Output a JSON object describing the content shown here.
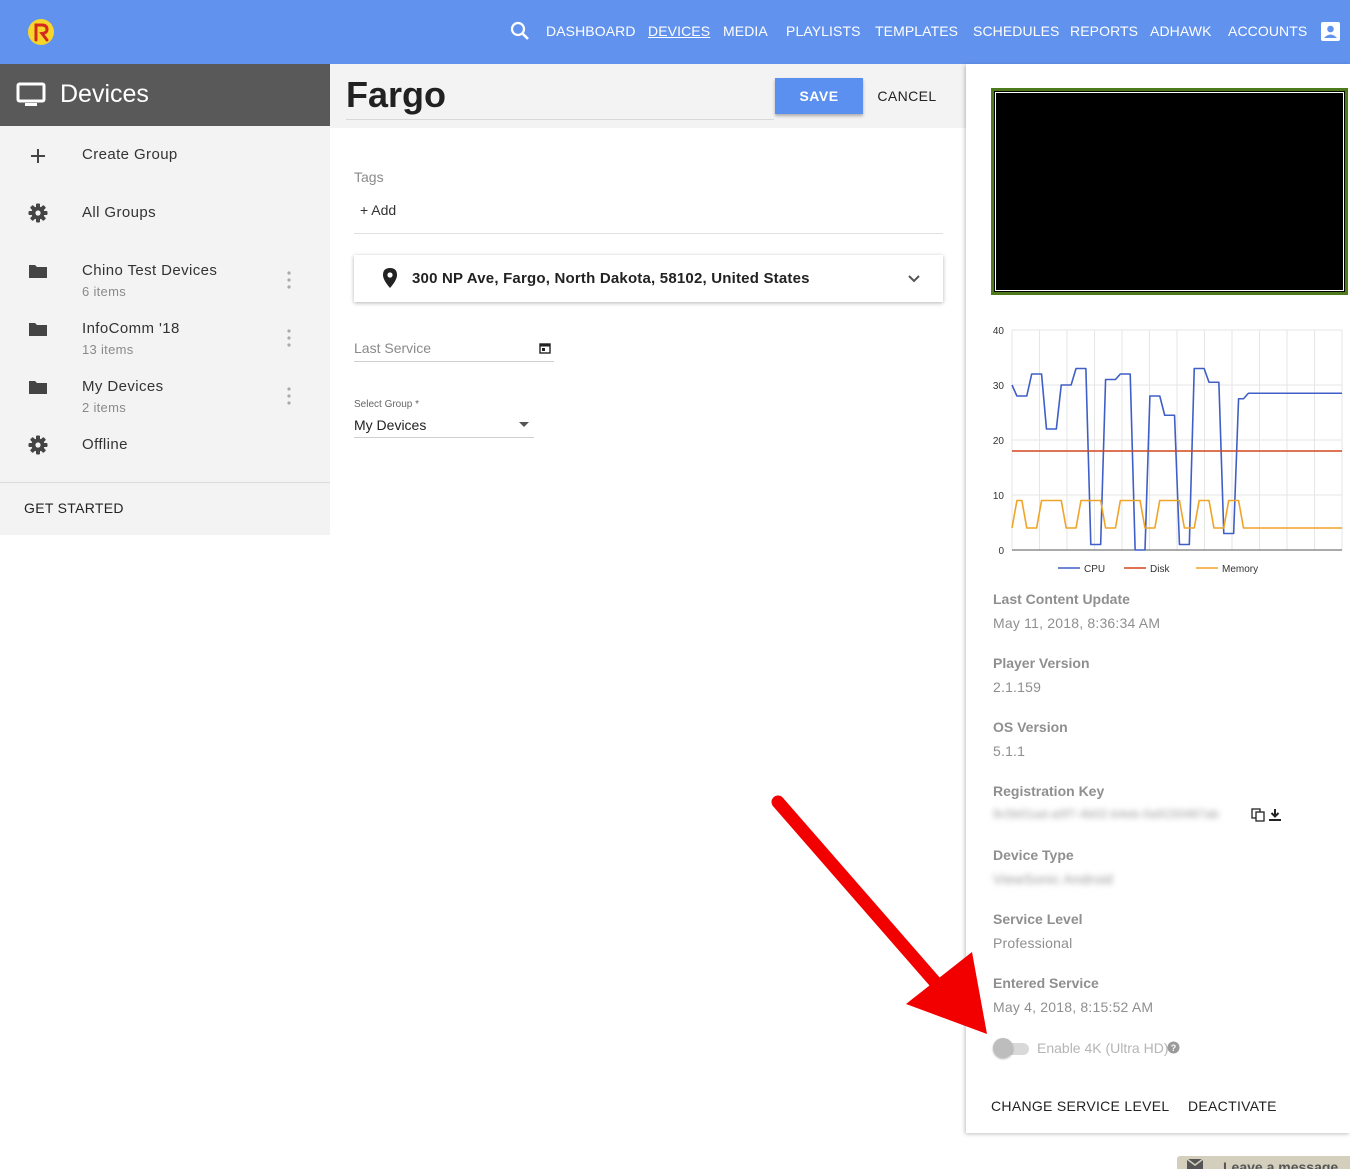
{
  "nav": {
    "items": [
      "DASHBOARD",
      "DEVICES",
      "MEDIA",
      "PLAYLISTS",
      "TEMPLATES",
      "SCHEDULES",
      "REPORTS",
      "ADHAWK",
      "ACCOUNTS"
    ],
    "active": "DEVICES",
    "brand_color": "#6193ee"
  },
  "sidebar": {
    "title": "Devices",
    "items": [
      {
        "label": "Create Group",
        "icon": "plus-icon"
      },
      {
        "label": "All Groups",
        "icon": "gear-icon"
      },
      {
        "label": "Chino Test Devices",
        "sub": "6 items",
        "icon": "folder-icon"
      },
      {
        "label": "InfoComm '18",
        "sub": "13 items",
        "icon": "folder-icon"
      },
      {
        "label": "My Devices",
        "sub": "2 items",
        "icon": "folder-icon"
      },
      {
        "label": "Offline",
        "icon": "gear-icon"
      }
    ],
    "get_started": "GET STARTED"
  },
  "editor": {
    "device_name": "Fargo",
    "save_label": "SAVE",
    "cancel_label": "CANCEL",
    "tags_label": "Tags",
    "tags_add": "+ Add",
    "address": "300 NP Ave, Fargo, North Dakota, 58102, United States",
    "last_service_placeholder": "Last Service",
    "select_group_label": "Select Group *",
    "select_group_value": "My Devices"
  },
  "details": {
    "fields": [
      {
        "label": "Last Content Update",
        "value": "May 11, 2018, 8:36:34 AM"
      },
      {
        "label": "Player Version",
        "value": "2.1.159"
      },
      {
        "label": "OS Version",
        "value": "5.1.1"
      },
      {
        "label": "Registration Key",
        "value": "9c5b01ad-a0f7-4b02-b4eb-0a9150487ab",
        "blurred": true
      },
      {
        "label": "Device Type",
        "value": "ViewSonic Android",
        "blurred": true
      },
      {
        "label": "Service Level",
        "value": "Professional"
      },
      {
        "label": "Entered Service",
        "value": "May 4, 2018, 8:15:52 AM"
      }
    ],
    "toggle_4k_label": "Enable 4K (Ultra HD)",
    "toggle_4k_on": false,
    "change_service_level": "CHANGE SERVICE LEVEL",
    "deactivate": "DEACTIVATE"
  },
  "leave_message": "Leave a message",
  "chart_data": {
    "type": "line",
    "ylim": [
      0,
      40
    ],
    "yticks": [
      0,
      10,
      20,
      30,
      40
    ],
    "x": [
      0,
      0.25,
      0.5,
      0.75,
      1,
      1.25,
      1.5,
      1.75,
      2,
      2.25,
      2.5,
      2.75,
      3,
      3.25,
      3.5,
      3.75,
      4,
      4.25,
      4.5,
      4.75,
      5,
      5.25,
      5.5,
      5.75,
      6,
      6.25,
      6.5,
      6.75,
      7,
      7.25,
      7.5,
      7.75,
      8,
      8.25,
      8.5,
      8.75,
      9,
      9.25,
      9.5,
      9.75,
      10,
      10.25,
      10.5,
      10.75,
      11,
      11.25,
      11.5,
      11.75,
      12,
      12.25,
      12.5,
      12.75,
      13,
      13.25,
      13.5,
      13.75,
      14,
      14.25,
      14.5,
      14.75,
      15,
      15.25,
      15.5,
      15.75,
      16,
      16.25,
      16.5,
      16.75
    ],
    "series": [
      {
        "name": "CPU",
        "color": "#3f5fc7",
        "values": [
          30,
          28,
          28,
          28,
          32,
          32,
          32,
          22,
          22,
          22,
          30,
          30,
          30,
          33,
          33,
          33,
          1,
          1,
          1,
          31,
          31,
          31,
          32,
          32,
          32,
          0,
          0,
          0,
          28,
          28,
          28,
          24.5,
          24.5,
          24.5,
          1,
          1,
          1,
          33,
          33,
          33,
          30.5,
          30.5,
          30.5,
          3,
          3,
          3,
          27.5,
          27.5,
          28.5,
          28.5,
          28.5,
          28.5,
          28.5,
          28.5,
          28.5,
          28.5,
          28.5,
          28.5,
          28.5,
          28.5,
          28.5,
          28.5,
          28.5,
          28.5,
          28.5,
          28.5,
          28.5,
          28.5
        ]
      },
      {
        "name": "Disk",
        "color": "#d2461f",
        "values": [
          18,
          18,
          18,
          18,
          18,
          18,
          18,
          18,
          18,
          18,
          18,
          18,
          18,
          18,
          18,
          18,
          18,
          18,
          18,
          18,
          18,
          18,
          18,
          18,
          18,
          18,
          18,
          18,
          18,
          18,
          18,
          18,
          18,
          18,
          18,
          18,
          18,
          18,
          18,
          18,
          18,
          18,
          18,
          18,
          18,
          18,
          18,
          18,
          18,
          18,
          18,
          18,
          18,
          18,
          18,
          18,
          18,
          18,
          18,
          18,
          18,
          18,
          18,
          18,
          18,
          18,
          18,
          18
        ]
      },
      {
        "name": "Memory",
        "color": "#f0a427",
        "values": [
          4,
          9,
          9,
          4,
          4,
          4,
          9,
          9,
          9,
          9,
          9,
          4,
          4,
          4,
          9,
          9,
          9,
          9,
          9,
          4,
          4,
          4,
          9,
          9,
          9,
          9,
          9,
          4,
          4,
          4,
          9,
          9,
          9,
          9,
          9,
          4,
          4,
          4,
          9,
          9,
          9,
          4,
          4,
          4,
          9,
          9,
          9,
          4,
          4,
          4,
          4,
          4,
          4,
          4,
          4,
          4,
          4,
          4,
          4,
          4,
          4,
          4,
          4,
          4,
          4,
          4,
          4,
          4
        ]
      }
    ],
    "legend_position": "bottom",
    "grid": true
  }
}
